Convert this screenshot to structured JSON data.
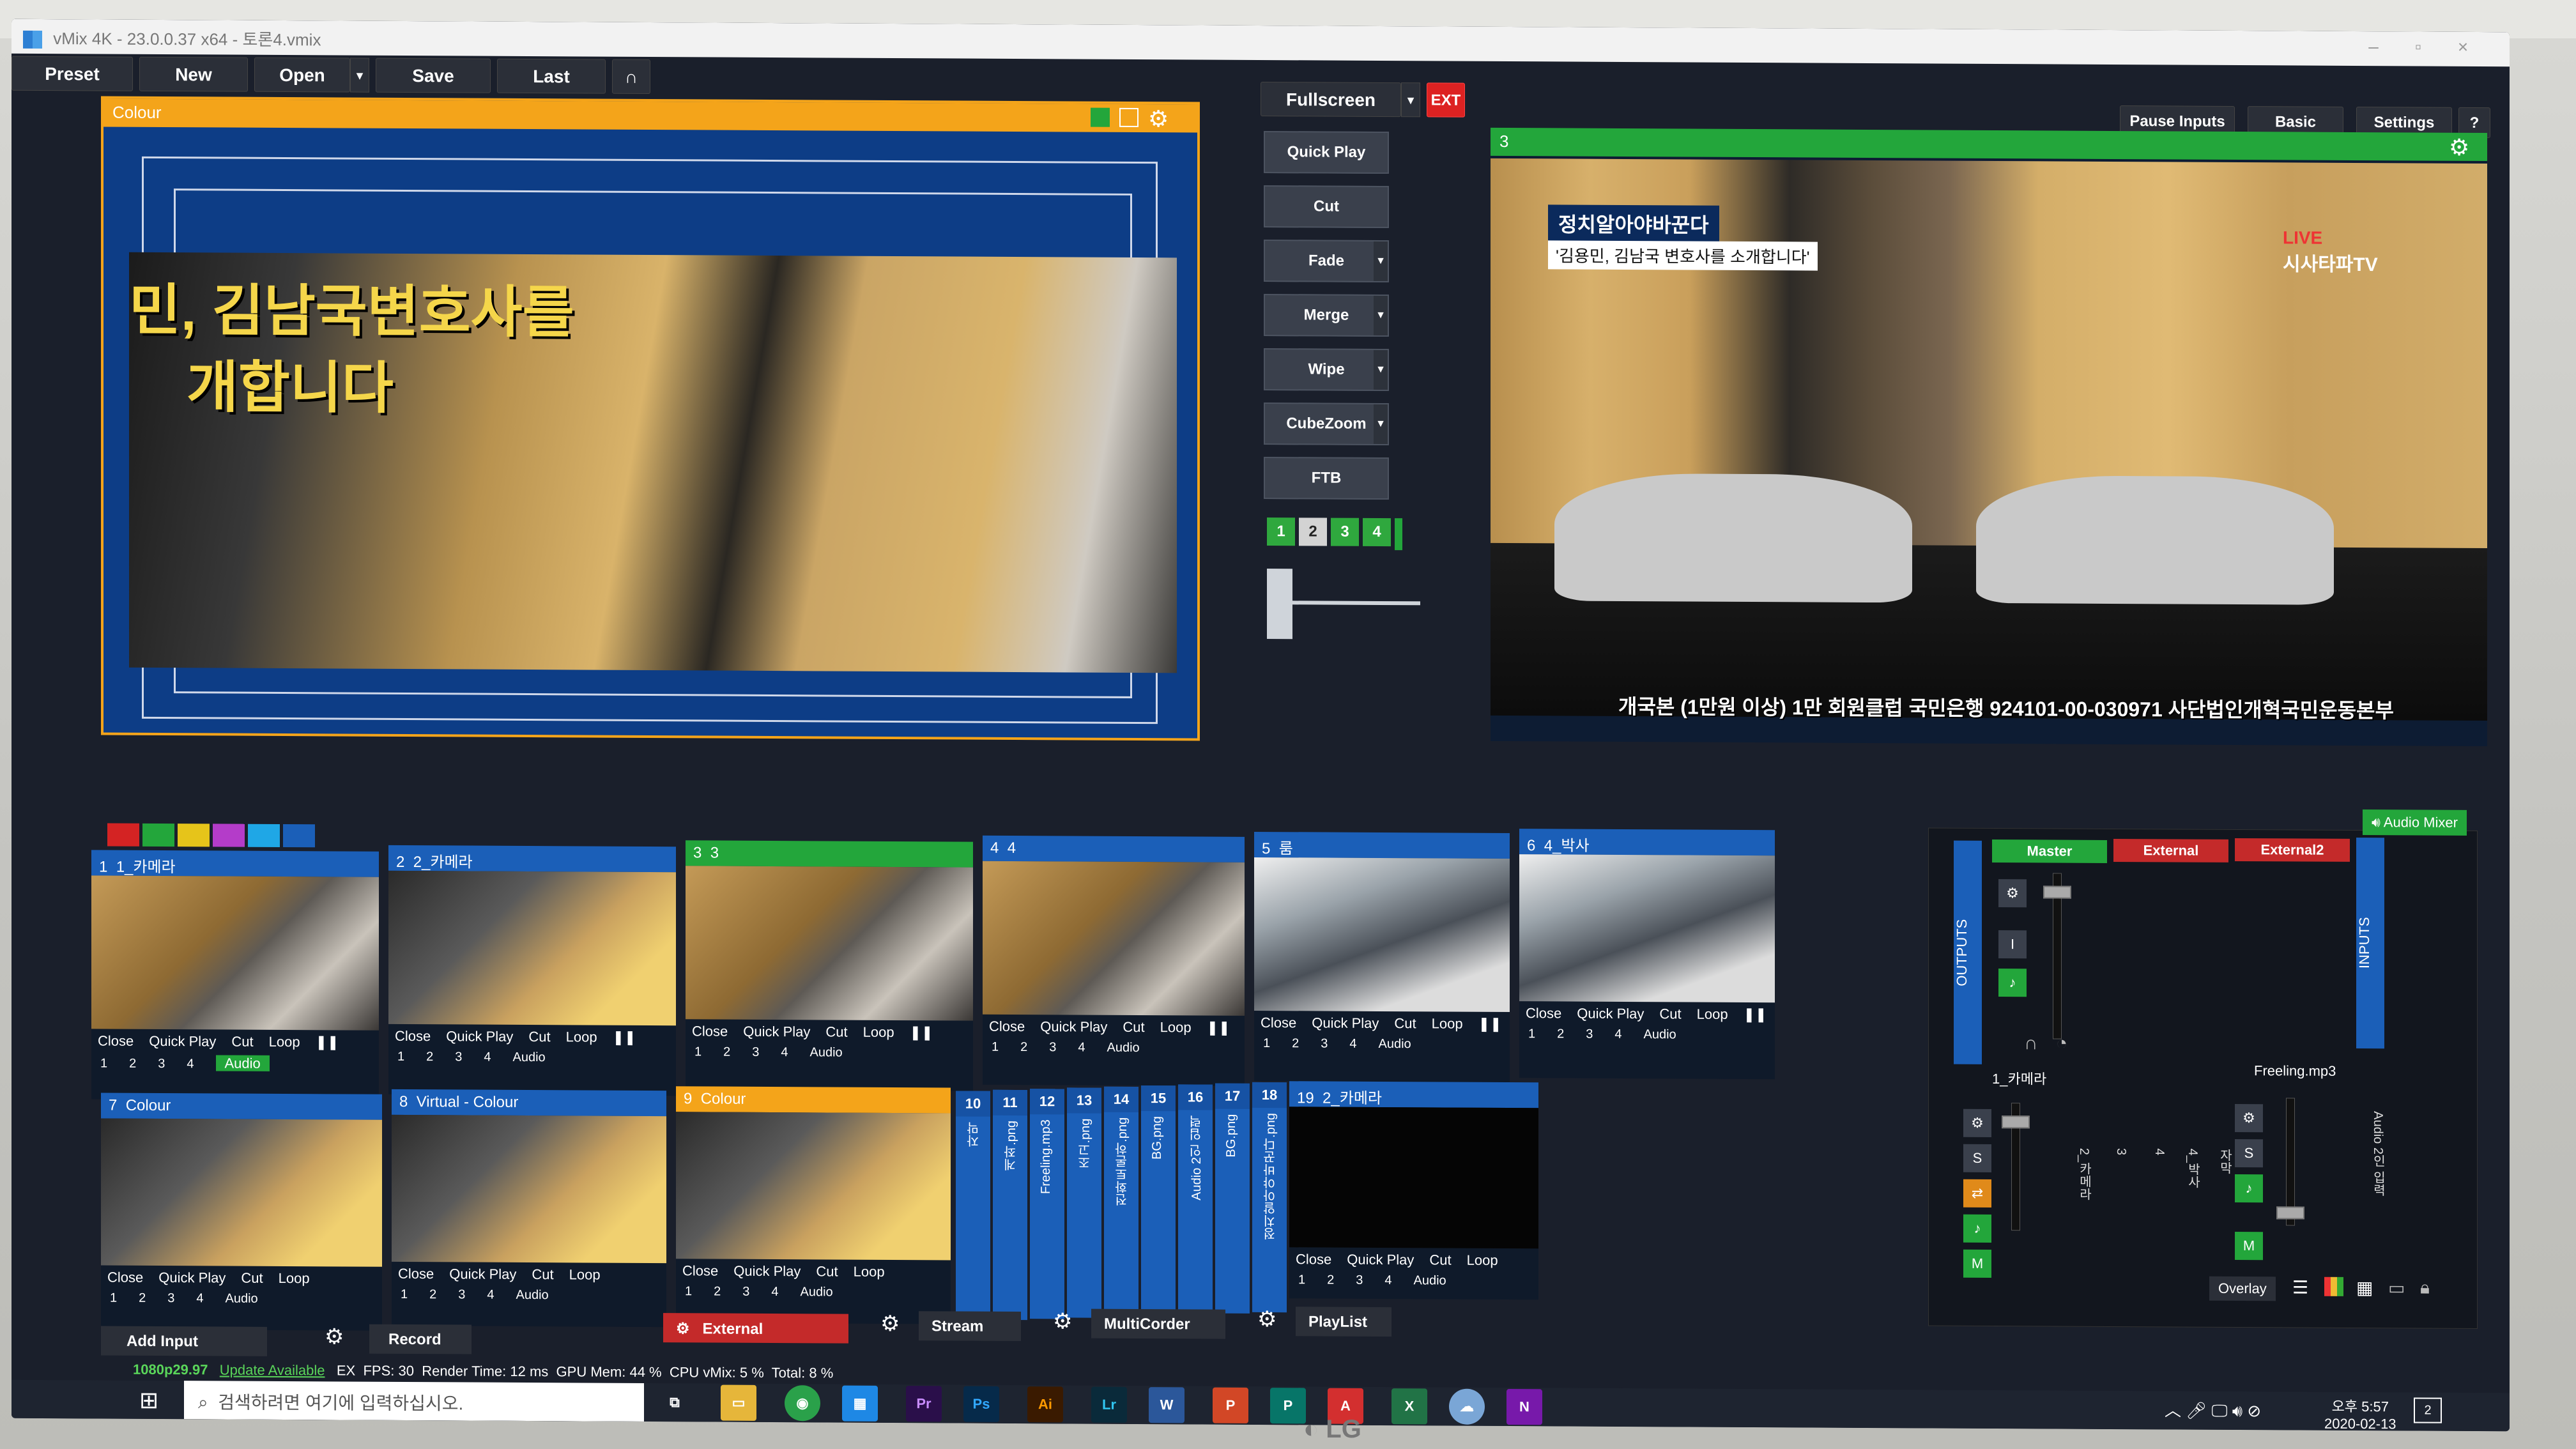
{
  "window": {
    "title": "vMix 4K - 23.0.0.37 x64 - 토론4.vmix"
  },
  "toolbar": {
    "preset": "Preset",
    "new": "New",
    "open": "Open",
    "save": "Save",
    "last": "Last",
    "fullscreen": "Fullscreen",
    "ext": "EXT",
    "pause_inputs": "Pause Inputs",
    "basic": "Basic",
    "settings": "Settings",
    "help": "?"
  },
  "preview": {
    "title": "Colour",
    "overlay_text1": "민, 김남국변호사를",
    "overlay_text2": "개합니다"
  },
  "transitions": {
    "quick_play": "Quick Play",
    "cut": "Cut",
    "fade": "Fade",
    "merge": "Merge",
    "wipe": "Wipe",
    "cubezoom": "CubeZoom",
    "ftb": "FTB",
    "slots": [
      "1",
      "2",
      "3",
      "4"
    ]
  },
  "output": {
    "number": "3",
    "caption_title": "정치알아야바꾼다",
    "caption_sub": "'김용민, 김남국 변호사를 소개합니다'",
    "live": "LIVE",
    "brand": "시사타파TV",
    "ticker": "개국본 (1만원 이상) 1만 회원클럽 국민은행 924101-00-030971 사단법인개혁국민운동본부"
  },
  "inputs": [
    {
      "num": "1",
      "name": "1_카메라",
      "style": "blue"
    },
    {
      "num": "2",
      "name": "2_카메라",
      "style": "blue"
    },
    {
      "num": "3",
      "name": "3",
      "style": "green"
    },
    {
      "num": "4",
      "name": "4",
      "style": "blue"
    },
    {
      "num": "5",
      "name": "룸",
      "style": "blue"
    },
    {
      "num": "6",
      "name": "4_박사",
      "style": "blue"
    },
    {
      "num": "7",
      "name": "Colour",
      "style": "blue"
    },
    {
      "num": "8",
      "name": "Virtual - Colour",
      "style": "blue"
    },
    {
      "num": "9",
      "name": "Colour",
      "style": "orange"
    },
    {
      "num": "19",
      "name": "2_카메라",
      "style": "blue"
    }
  ],
  "input_controls": {
    "close": "Close",
    "quick_play": "Quick Play",
    "cut": "Cut",
    "loop": "Loop",
    "audio": "Audio",
    "n1": "1",
    "n2": "2",
    "n3": "3",
    "n4": "4"
  },
  "vertical_inputs": [
    {
      "num": "10",
      "label": "자막"
    },
    {
      "num": "11",
      "label": "계좌.png"
    },
    {
      "num": "12",
      "label": "Freeling.mp3"
    },
    {
      "num": "13",
      "label": "조고.png"
    },
    {
      "num": "14",
      "label": "전화토론하.png"
    },
    {
      "num": "15",
      "label": "BG.png"
    },
    {
      "num": "16",
      "label": "Audio 2인 입력"
    },
    {
      "num": "17",
      "label": "BG.png"
    },
    {
      "num": "18",
      "label": "정치알아야바꾼다.png"
    }
  ],
  "bottom_bar": {
    "add_input": "Add Input",
    "record": "Record",
    "external": "External",
    "stream": "Stream",
    "multicorder": "MultiCorder",
    "playlist": "PlayList",
    "overlay": "Overlay"
  },
  "status": {
    "resolution": "1080p29.97",
    "update": "Update Available",
    "ex": "EX",
    "fps_label": "FPS:",
    "fps": "30",
    "render_label": "Render Time:",
    "render": "12 ms",
    "gpu_label": "GPU Mem:",
    "gpu": "44 %",
    "cpu_label": "CPU vMix:",
    "cpu": "5 %",
    "total_label": "Total:",
    "total": "8 %"
  },
  "audio_mixer": {
    "title": "Audio Mixer",
    "outputs": "OUTPUTS",
    "inputs": "INPUTS",
    "master": "Master",
    "external": "External",
    "external2": "External2",
    "ch1": "1_카메라",
    "ch2": "2_카메라",
    "ch3": "3",
    "ch4": "4",
    "ch5": "4_박사",
    "ch6": "자막",
    "freeling": "Freeling.mp3",
    "audio2": "Audio 2인 입력",
    "s": "S",
    "m": "M",
    "i": "I"
  },
  "taskbar": {
    "search": "검색하려면 여기에 입력하십시오.",
    "time": "오후 5:57",
    "date": "2020-02-13",
    "notif": "2"
  },
  "monitor": {
    "brand": "LG"
  },
  "colors": {
    "accent_orange": "#f4a41a",
    "active_green": "#23a63b",
    "input_blue": "#1b5fb8",
    "bg": "#1a1f2b"
  }
}
